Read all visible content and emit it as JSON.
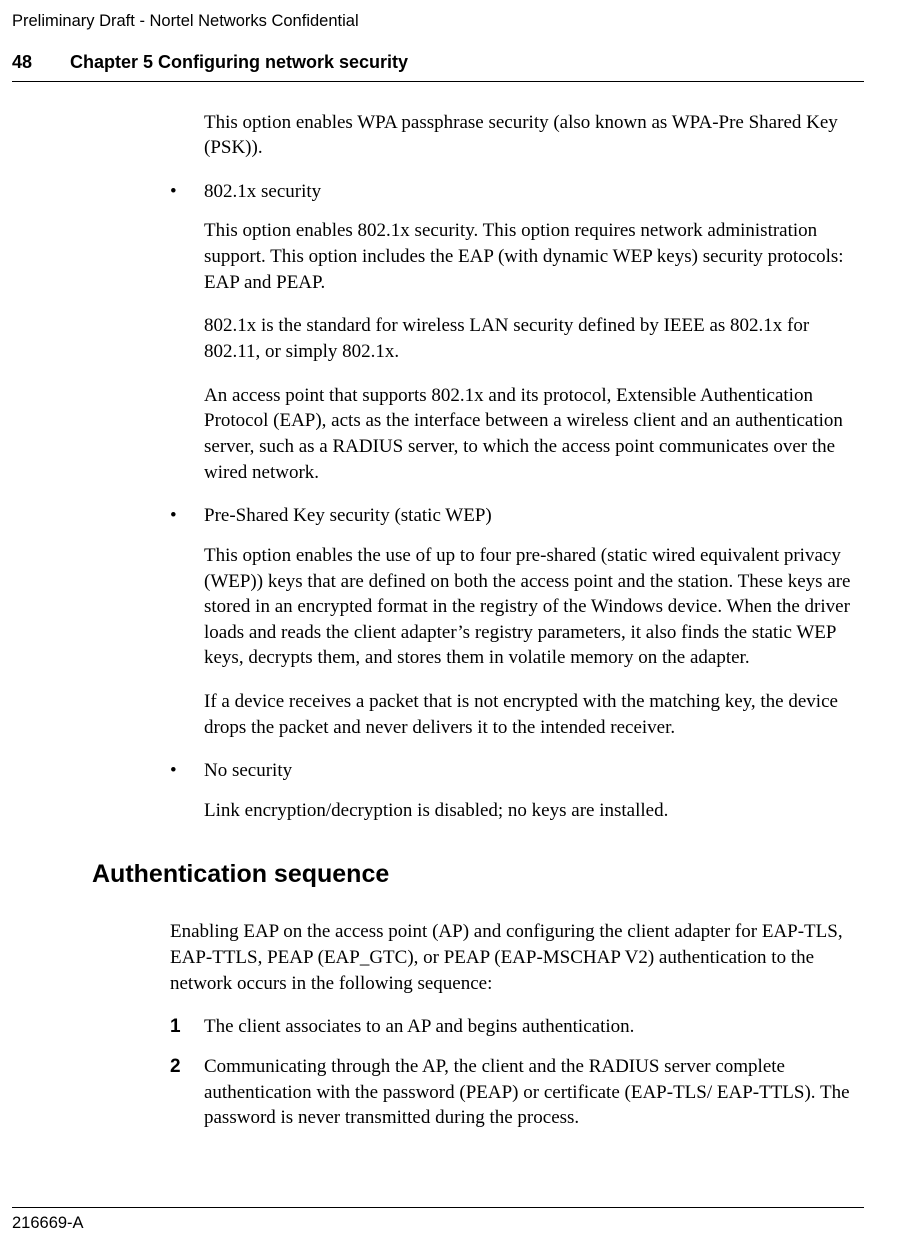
{
  "header": {
    "confidential": "Preliminary Draft - Nortel Networks Confidential",
    "page_number": "48",
    "chapter_title": "Chapter 5 Configuring network security"
  },
  "content": {
    "intro_para": "This option enables WPA passphrase security (also known as WPA-Pre Shared Key (PSK)).",
    "bullets": {
      "b1": {
        "title": "802.1x security",
        "p1": "This option enables 802.1x security. This option requires network administration support. This option includes the EAP (with dynamic WEP keys) security protocols: EAP and PEAP.",
        "p2": "802.1x is the standard for wireless LAN security defined by IEEE as 802.1x for 802.11, or simply 802.1x.",
        "p3": "An access point that supports 802.1x and its protocol, Extensible Authentication Protocol (EAP), acts as the interface between a wireless client and an authentication server, such as a RADIUS server, to which the access point communicates over the wired network."
      },
      "b2": {
        "title": "Pre-Shared Key security (static WEP)",
        "p1": "This option enables the use of up to four pre-shared (static wired equivalent privacy (WEP)) keys that are defined on both the access point and the station. These keys are stored in an encrypted format in the registry of the Windows device. When the driver loads and reads the client adapter’s registry parameters, it also finds the static WEP keys, decrypts them, and stores them in volatile memory on the adapter.",
        "p2": "If a device receives a packet that is not encrypted with the matching key, the device drops the packet and never delivers it to the intended receiver."
      },
      "b3": {
        "title": "No security",
        "p1": "Link encryption/decryption is disabled; no keys are installed."
      }
    },
    "section_heading": "Authentication sequence",
    "section_intro": "Enabling EAP on the access point (AP) and configuring the client adapter for EAP-TLS, EAP-TTLS, PEAP (EAP_GTC), or PEAP (EAP-MSCHAP V2) authentication to the network occurs in the following sequence:",
    "steps": {
      "s1": {
        "num": "1",
        "text": "The client associates to an AP and begins authentication."
      },
      "s2": {
        "num": "2",
        "text": "Communicating through the AP, the client and the RADIUS server complete authentication with the password (PEAP) or certificate (EAP-TLS/ EAP-TTLS). The password is never transmitted during the process."
      }
    }
  },
  "footer": {
    "doc_id": "216669-A"
  },
  "glyphs": {
    "bullet": "•"
  }
}
